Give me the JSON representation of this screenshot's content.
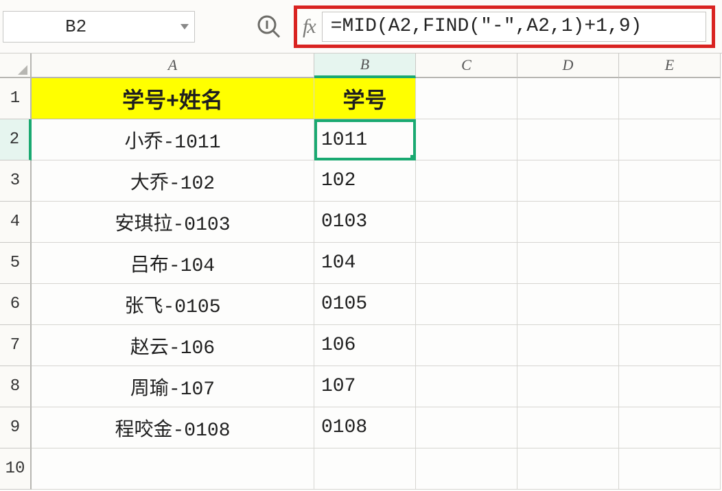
{
  "nameBox": "B2",
  "formula": "=MID(A2,FIND(\"-\",A2,1)+1,9)",
  "columns": [
    "A",
    "B",
    "C",
    "D",
    "E"
  ],
  "rowNumbers": [
    "1",
    "2",
    "3",
    "4",
    "5",
    "6",
    "7",
    "8",
    "9",
    "10"
  ],
  "headers": {
    "A": "学号+姓名",
    "B": "学号"
  },
  "rows": [
    {
      "a": "小乔-1011",
      "b": "1011"
    },
    {
      "a": "大乔-102",
      "b": "102"
    },
    {
      "a": "安琪拉-0103",
      "b": "0103"
    },
    {
      "a": "吕布-104",
      "b": "104"
    },
    {
      "a": "张飞-0105",
      "b": "0105"
    },
    {
      "a": "赵云-106",
      "b": "106"
    },
    {
      "a": "周瑜-107",
      "b": "107"
    },
    {
      "a": "程咬金-0108",
      "b": "0108"
    }
  ],
  "selectedCell": "B2"
}
